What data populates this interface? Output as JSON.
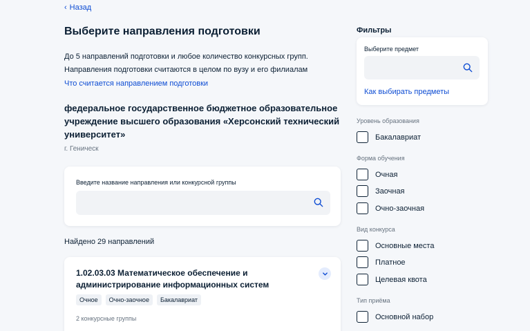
{
  "nav": {
    "back_label": "Назад"
  },
  "main": {
    "title": "Выберите направления подготовки",
    "intro_line1": "До 5 направлений подготовки и любое количество конкурсных групп.",
    "intro_line2": "Направления подготовки считаются в целом по вузу и его филиалам",
    "what_link": "Что считается направлением подготовки",
    "university": "федеральное государственное бюджетное образовательное учреждение высшего образования «Херсонский технический университет»",
    "city": "г. Геническ",
    "search": {
      "label": "Введите название направления или конкурсной группы",
      "value": "",
      "placeholder": ""
    },
    "found": "Найдено 29 направлений",
    "results": [
      {
        "title": "1.02.03.03 Математическое обеспечение и администрирование информационных систем",
        "tags": [
          "Очное",
          "Очно-заочное",
          "Бакалавриат"
        ],
        "groups": "2 конкурсные группы"
      }
    ]
  },
  "sidebar": {
    "title": "Фильтры",
    "subject": {
      "label": "Выберите предмет",
      "value": "",
      "placeholder": "",
      "link": "Как выбирать предметы"
    },
    "level": {
      "heading": "Уровень образования",
      "options": [
        "Бакалавриат"
      ]
    },
    "form": {
      "heading": "Форма обучения",
      "options": [
        "Очная",
        "Заочная",
        "Очно-заочная"
      ]
    },
    "contest": {
      "heading": "Вид конкурса",
      "options": [
        "Основные места",
        "Платное",
        "Целевая квота"
      ]
    },
    "admission": {
      "heading": "Тип приёма",
      "options": [
        "Основной набор"
      ]
    }
  },
  "colors": {
    "accent": "#0d4cd3",
    "text": "#0b1f33",
    "muted": "#66727f",
    "background": "#f5f7fa"
  },
  "icons": {
    "back": "chevron-left-icon",
    "search": "search-icon",
    "expand": "chevron-down-icon"
  }
}
